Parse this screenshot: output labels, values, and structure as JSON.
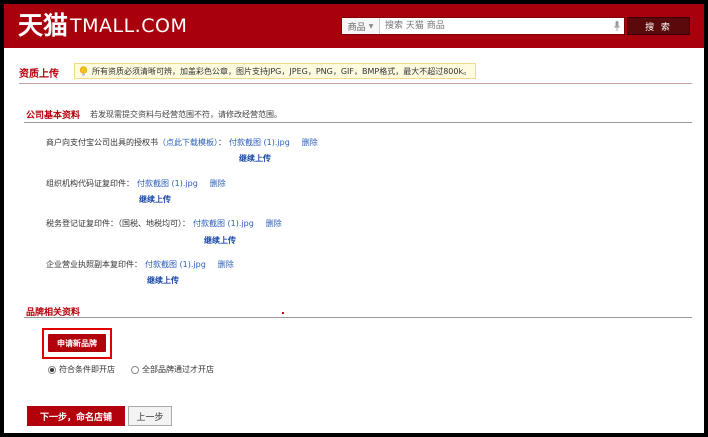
{
  "header": {
    "logo_cn": "天猫",
    "logo_en": "TMALL.COM",
    "search_scope": "商品",
    "search_placeholder": "搜索 天猫 商品",
    "search_button": "搜 索"
  },
  "section": {
    "title": "资质上传",
    "notice": "所有资质必须清晰可辨，加盖彩色公章，图片支持JPG，JPEG，PNG，GIF，BMP格式，最大不超过800k。"
  },
  "company": {
    "title": "公司基本资料",
    "hint": "若发现需提交资料与经营范围不符，请修改经营范围。",
    "fields": [
      {
        "label": "商户向支付宝公司出具的授权书",
        "template_link": "（点此下载模板）",
        "colon": "：",
        "file": "付款截图 (1).jpg",
        "delete": "删除",
        "continue": "继续上传"
      },
      {
        "label": "组织机构代码证复印件",
        "template_link": "",
        "colon": "：",
        "file": "付款截图 (1).jpg",
        "delete": "删除",
        "continue": "继续上传"
      },
      {
        "label": "税务登记证复印件：（国税、地税均可）",
        "template_link": "",
        "colon": "：",
        "file": "付款截图 (1).jpg",
        "delete": "删除",
        "continue": "继续上传"
      },
      {
        "label": "企业营业执照副本复印件",
        "template_link": "",
        "colon": "：",
        "file": "付款截图 (1).jpg",
        "delete": "删除",
        "continue": "继续上传"
      }
    ]
  },
  "brand": {
    "title": "品牌相关资料",
    "apply_button": "申请新品牌",
    "options": [
      {
        "label": "符合条件即开店",
        "selected": true
      },
      {
        "label": "全部品牌通过才开店",
        "selected": false
      }
    ]
  },
  "footer": {
    "next_button": "下一步，命名店铺",
    "prev_button": "上一步"
  },
  "colors": {
    "brand_red": "#a8000d",
    "button_red": "#b2000c",
    "link_blue": "#2a5ebd"
  }
}
